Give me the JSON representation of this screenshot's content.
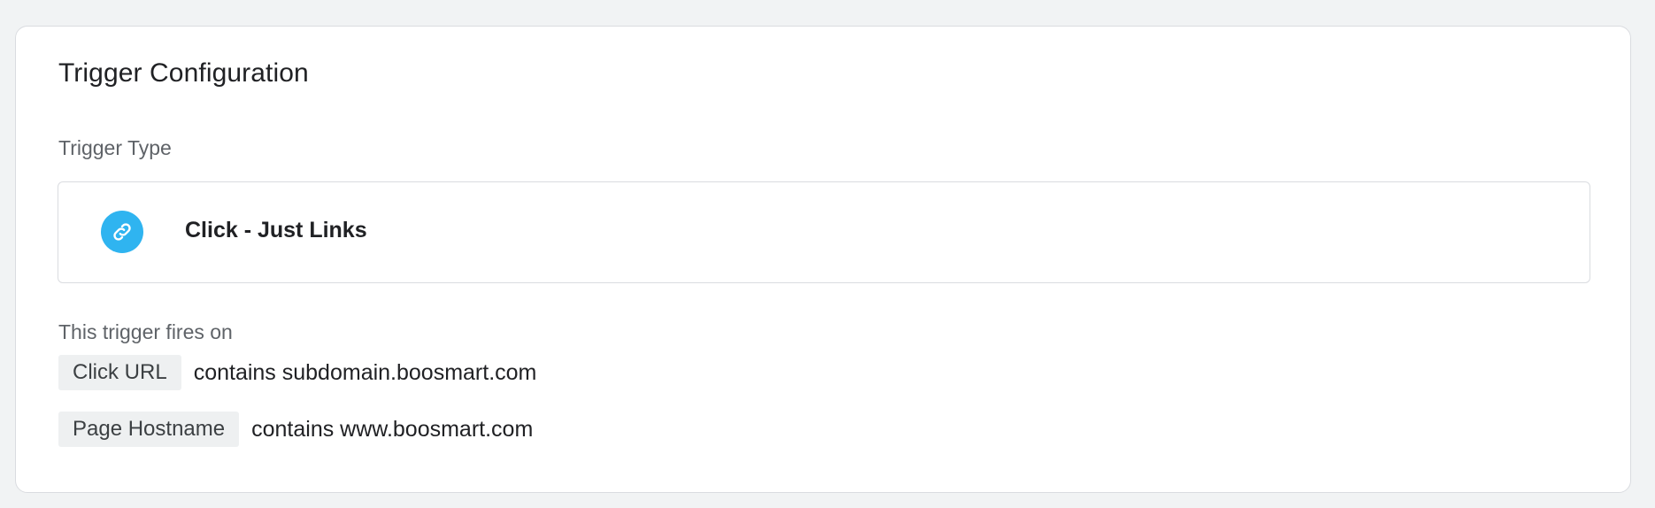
{
  "card": {
    "title": "Trigger Configuration",
    "trigger_type_label": "Trigger Type",
    "trigger_type": {
      "name": "Click - Just Links",
      "icon": "link-icon",
      "icon_color": "#2fb4f0"
    },
    "fires_on_label": "This trigger fires on",
    "conditions": [
      {
        "variable": "Click URL",
        "operator_value": "contains subdomain.boosmart.com"
      },
      {
        "variable": "Page Hostname",
        "operator_value": "contains www.boosmart.com"
      }
    ]
  },
  "colors": {
    "page_background": "#f1f3f4",
    "card_background": "#ffffff",
    "border": "#dadce0",
    "chip_background": "#eef0f1",
    "secondary_text": "#5f6368"
  }
}
